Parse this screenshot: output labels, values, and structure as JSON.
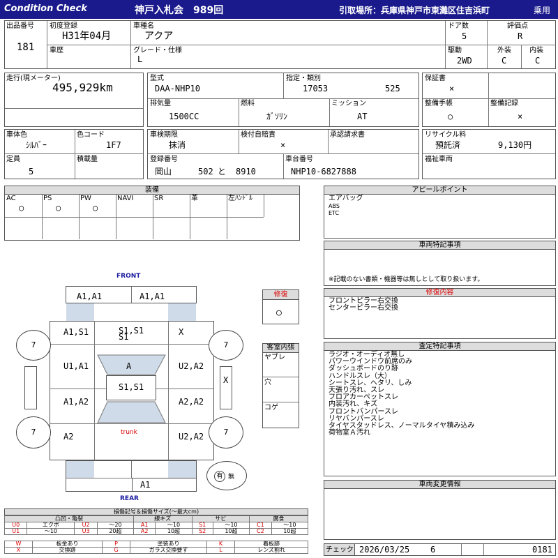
{
  "header": {
    "title": "Condition  Check",
    "auction": "神戸入札会　989回",
    "pickup": "引取場所：兵庫県神戸市東灘区住吉浜町",
    "usage": "乗用"
  },
  "info": {
    "lot_label": "出品番号",
    "lot": "181",
    "first_reg_label": "初度登録",
    "first_reg": "H31年04月",
    "history_label": "車歴",
    "model_name_label": "車種名",
    "model_name": "アクア",
    "grade_label": "グレード・仕様",
    "grade": "L",
    "doors_label": "ドア数",
    "doors": "5",
    "rating_label": "評価点",
    "rating": "R",
    "drive_label": "駆動",
    "drive": "2WD",
    "exterior_label": "外装",
    "exterior": "C",
    "interior_label": "内装",
    "interior": "C",
    "mileage_label": "走行(現メーター)",
    "mileage": "495,929km",
    "type_label": "型式",
    "type": "DAA-NHP10",
    "designation_label": "指定・類別",
    "designation": "17053",
    "category": "525",
    "warranty_label": "保証書",
    "warranty": "×",
    "displacement_label": "排気量",
    "displacement": "1500CC",
    "fuel_label": "燃料",
    "fuel": "ｶﾞｿﾘﾝ",
    "mission_label": "ミッション",
    "mission": "AT",
    "maint_book_label": "整備手帳",
    "maint_book": "○",
    "maint_record_label": "整備記録",
    "maint_record": "×",
    "color_label": "車体色",
    "color": "ｼﾙﾊﾞｰ",
    "color_code_label": "色コード",
    "color_code": "1F7",
    "inspection_label": "車検期限",
    "inspection": "抹消",
    "insurance_label": "検付自賠責",
    "insurance": "×",
    "claim_label": "承認請求書",
    "recycle_label": "リサイクル料",
    "recycle_status": "預託済",
    "recycle_fee": "9,130円",
    "capacity_label": "定員",
    "capacity": "5",
    "load_label": "積載量",
    "plate_label": "登録番号",
    "plate_area": "岡山",
    "plate_class": "502",
    "plate_kana": "と",
    "plate_num": "8910",
    "chassis_label": "車台番号",
    "chassis": "NHP10-6827888",
    "welfare_label": "福祉車両"
  },
  "equipment": {
    "title": "装備",
    "cols": [
      "AC",
      "PS",
      "PW",
      "NAVI",
      "SR",
      "革",
      "左ﾊﾝﾄﾞﾙ"
    ],
    "vals": [
      "○",
      "○",
      "○",
      "",
      "",
      "",
      ""
    ]
  },
  "appeal": {
    "title": "アピールポイント",
    "items": [
      "エアバッグ",
      "ABS",
      "ETC"
    ]
  },
  "special": {
    "title": "車両特記事項",
    "note": "※記載のない書類・機器等は無しとして取り扱います。"
  },
  "repair_content": {
    "title": "修復内容",
    "items": [
      "フロントピラー右交換",
      "センターピラー右交換"
    ]
  },
  "inspector_notes": {
    "title": "査定特記事項",
    "items": [
      "ラジオ・オーディオ無し",
      "パワーウインドウ前席のみ",
      "ダッシュボードのり跡",
      "ハンドルスレ（大）",
      "シートスレ、ヘタリ、しみ",
      "天張り汚れ、スレ",
      "フロアカーペットスレ",
      "内装汚れ、キズ",
      "フロントバンパースレ",
      "リヤバンパースレ",
      "タイヤスタッドレス、ノーマルタイヤ積み込み",
      "荷物室Ａ汚れ"
    ]
  },
  "change_info": {
    "title": "車両変更情報"
  },
  "repair": {
    "title": "修復",
    "value": "○"
  },
  "cabin": {
    "title": "客室内張",
    "rows": [
      "ヤブレ",
      "穴",
      "コゲ"
    ]
  },
  "diagram": {
    "front": "FRONT",
    "rear": "REAR",
    "trunk": "trunk",
    "marks": {
      "front_left": "A1,A1",
      "front_right": "A1,A1",
      "hood_left": "A1,S1",
      "hood_center": "S1,S1\nS1",
      "hood_right": "X",
      "door_fl": "U1,A1",
      "roof_front": "A",
      "door_fr": "U2,A2",
      "roof": "S1,S1",
      "door_rl": "A1,A2",
      "door_rr": "A2,A2",
      "rear_left": "A2",
      "rear_right": "U2,A2",
      "rear_bumper": "A1",
      "mirror_right": "X",
      "tire_fl": "7",
      "tire_fr": "7",
      "tire_rl": "7",
      "tire_rr": "7",
      "spare_yes": "有",
      "spare_no": "無"
    }
  },
  "legend": {
    "title": "損傷記号＆損傷サイズ(〜最大cm)",
    "groups": [
      "凸凹・亀裂",
      "線キズ",
      "サビ",
      "腐食"
    ],
    "row1": [
      "U0",
      "エクボ",
      "U2",
      "〜20",
      "A1",
      "〜10",
      "S1",
      "〜10",
      "C1",
      "〜10"
    ],
    "row2": [
      "U1",
      "〜10",
      "U3",
      "20超",
      "A2",
      "10超",
      "S2",
      "10超",
      "C2",
      "10超"
    ],
    "row3": [
      "W",
      "板金あり",
      "P",
      "塗装あり",
      "K",
      "着板跡"
    ],
    "row4": [
      "X",
      "交換跡",
      "G",
      "ガラス交換要す",
      "L",
      "レンズ割れ"
    ]
  },
  "footer": {
    "check_label": "チェック",
    "date": "2026/03/25",
    "num": "6",
    "code": "0181"
  }
}
